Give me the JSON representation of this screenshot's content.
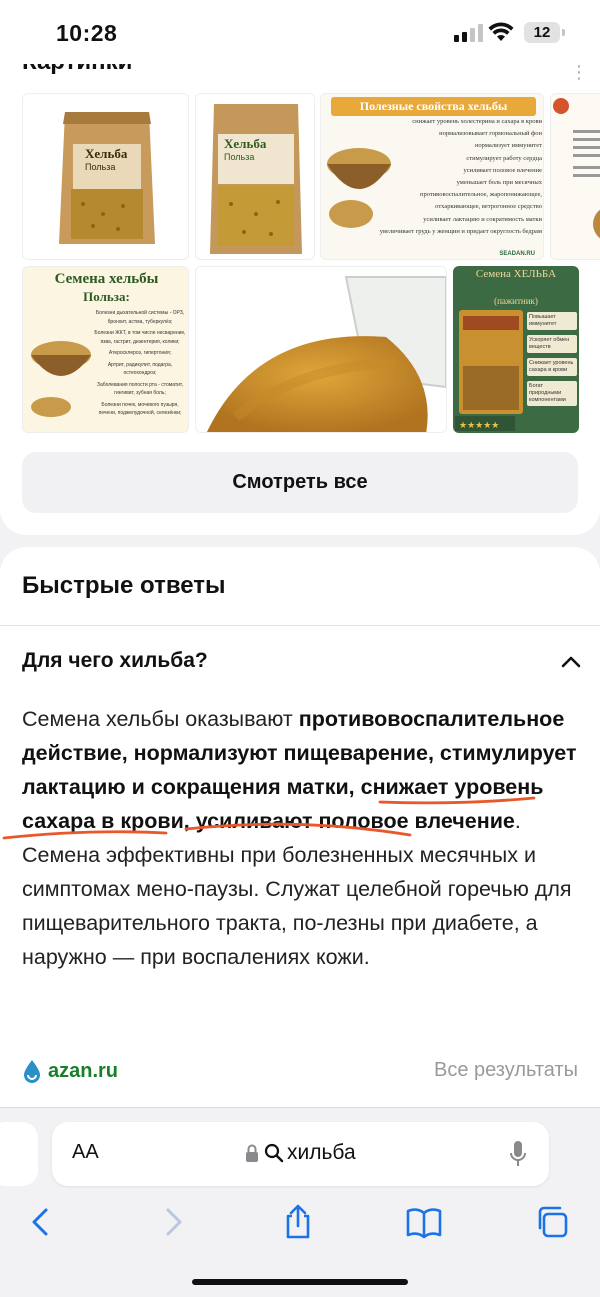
{
  "status_bar": {
    "time": "10:28",
    "battery": "12"
  },
  "images_section": {
    "title": "Картинки",
    "see_all_label": "Смотреть все",
    "thumbs": [
      {
        "kind": "product-bag",
        "label": "Хельба",
        "sub": "Польза"
      },
      {
        "kind": "product-bag",
        "label": "Хельба",
        "sub": "Польза"
      },
      {
        "kind": "infographic",
        "title": "Полезные свойства хельбы",
        "credit": "SEADAN.RU",
        "lines": [
          "снижает уровень холестерина и сахара в крови",
          "нормализовывает гормональный фон",
          "нормализует иммунитет",
          "стимулирует работу сердца",
          "усиливает половое влечение",
          "уменьшает боль при месячных",
          "противовоспалительное, жаропонижающее,",
          "отхаркивающее, ветрогонное средство",
          "усиливает лактацию и сократимость матки",
          "увеличивает грудь у женщин и придает округлость бедрам"
        ]
      },
      {
        "kind": "infographic-partial"
      },
      {
        "kind": "infographic",
        "title": "Семена хельбы",
        "sub": "Польза:",
        "lines": [
          "Болезни дыхательной системы - ОРЗ, бронхит, астма, туберкулёз;",
          "Болезни ЖКТ, в том числе несварение, язва, гастрит, дизентерия, колики;",
          "Атеросклероз, гипертония;",
          "Артрит, радикулит, подагра, остеохондроз;",
          "Заболевания полости рта - стоматит, гингивит, зубная боль;",
          "Болезни почек, мочевого пузыря, печени, поджелудочной, селезёнки;"
        ]
      },
      {
        "kind": "seeds-jar"
      },
      {
        "kind": "product-card",
        "title": "Семена ХЕЛЬБА",
        "sub": "(пажитник)",
        "lines": [
          "Повышает иммунитет",
          "Ускоряет обмен веществ",
          "Снижает уровень сахара в крови",
          "Богат природными компонентами"
        ]
      }
    ]
  },
  "quick_answers": {
    "title": "Быстрые ответы",
    "question": "Для чего хильба?",
    "answer": {
      "t1": "Семена хельбы оказывают ",
      "b1": "противовоспалительное действие, нормализуют пищеварение, стимулирует лактацию и сокращения матки, снижает уровень сахара в крови, усиливают половое влечение",
      "t2": ". Семена эффективны при болезненных месячных и симптомах мено-паузы. Служат целебной горечью для пищеварительного тракта, по-лезны при диабете, а наружно — при воспалениях кожи."
    },
    "source": "azan.ru",
    "all_results": "Все результаты",
    "colors": {
      "underline": "#e8582b",
      "source": "#1a7f2b"
    }
  },
  "browser": {
    "text_size_label": "AA",
    "query": "хильба"
  }
}
